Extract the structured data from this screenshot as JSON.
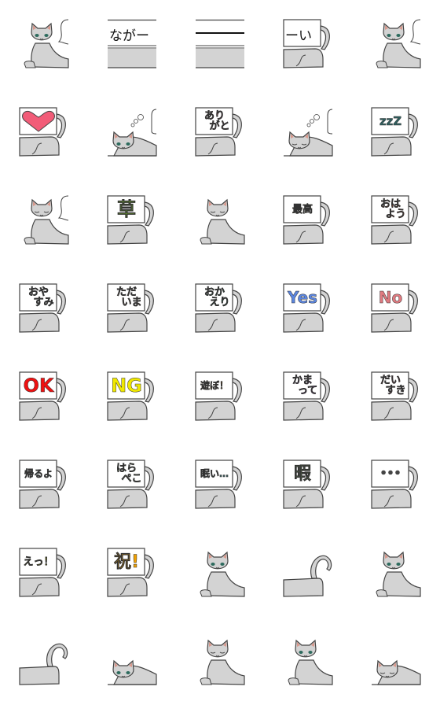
{
  "colors": {
    "cat_fill": "#d3d3d3",
    "outline": "#444444",
    "ear_pink": "#d89a8e",
    "eye_green": "#2e6b5e",
    "board": "#ffffff"
  },
  "stickers": [
    {
      "type": "cat-sit-bubble",
      "eyes": "open"
    },
    {
      "type": "strip",
      "text": "ながー"
    },
    {
      "type": "strip-line"
    },
    {
      "type": "sign-edge",
      "text": "ーい",
      "color": "#111111"
    },
    {
      "type": "cat-sit-bubble-right",
      "eyes": "open"
    },
    {
      "type": "sign-heart",
      "icon": "heart-icon",
      "color": "#f25c78"
    },
    {
      "type": "cat-sleep-bubble",
      "eyes": "open"
    },
    {
      "type": "sign",
      "text": "あり\n　がと",
      "color": "#c8586a",
      "size": 13
    },
    {
      "type": "cat-sleep-bubble",
      "eyes": "closed"
    },
    {
      "type": "sign",
      "text": "zzZ",
      "color": "#2f5f5f",
      "size": 15
    },
    {
      "type": "cat-sit-bubble",
      "eyes": "closed"
    },
    {
      "type": "sign",
      "text": "草",
      "color": "#7ec82a",
      "size": 24
    },
    {
      "type": "cat-sit",
      "eyes": "closed"
    },
    {
      "type": "sign",
      "text": "最高",
      "color": "#c8b400",
      "size": 13
    },
    {
      "type": "sign",
      "text": "おは\n　よう",
      "color": "#d84a1a",
      "size": 13
    },
    {
      "type": "sign",
      "text": "おや\n　すみ",
      "color": "#3f5a5a",
      "size": 13
    },
    {
      "type": "sign",
      "text": "ただ\n　いま",
      "color": "#b08060",
      "size": 13
    },
    {
      "type": "sign",
      "text": "おか\n　えり",
      "color": "#1aa06a",
      "size": 13
    },
    {
      "type": "sign",
      "text": "Yes",
      "color": "#5b86e0",
      "size": 20
    },
    {
      "type": "sign",
      "text": "No",
      "color": "#e07a80",
      "size": 20
    },
    {
      "type": "sign",
      "text": "OK",
      "color": "#ee1111",
      "size": 24
    },
    {
      "type": "sign",
      "text": "NG",
      "color": "#f0e800",
      "size": 24
    },
    {
      "type": "sign",
      "text": "遊ぼ！",
      "color": "#c87a10",
      "size": 12
    },
    {
      "type": "sign",
      "text": "かま\n　って",
      "color": "#a040c8",
      "size": 13
    },
    {
      "type": "sign",
      "text": "だい\n　すき",
      "color": "#c83a5a",
      "size": 13
    },
    {
      "type": "sign",
      "text": "帰るよ",
      "color": "#4a9a9a",
      "size": 12
    },
    {
      "type": "sign",
      "text": "はら\n　ぺこ",
      "color": "#7aa060",
      "size": 13
    },
    {
      "type": "sign",
      "text": "眠い…",
      "color": "#3a5a5a",
      "size": 12
    },
    {
      "type": "sign",
      "text": "暇",
      "color": "#7aa060",
      "size": 22
    },
    {
      "type": "sign",
      "text": "•••",
      "color": "#444444",
      "size": 14
    },
    {
      "type": "sign",
      "text": "えっ！",
      "color": "#c8c800",
      "size": 13
    },
    {
      "type": "sign",
      "text": "祝!",
      "color": "#f0a000",
      "size": 22
    },
    {
      "type": "cat-sit",
      "eyes": "open"
    },
    {
      "type": "tail-only"
    },
    {
      "type": "cat-sit",
      "eyes": "open"
    },
    {
      "type": "tail-only"
    },
    {
      "type": "cat-sleep",
      "eyes": "open"
    },
    {
      "type": "cat-sit",
      "eyes": "closed"
    },
    {
      "type": "cat-sit",
      "eyes": "open"
    },
    {
      "type": "cat-sleep",
      "eyes": "closed"
    }
  ]
}
